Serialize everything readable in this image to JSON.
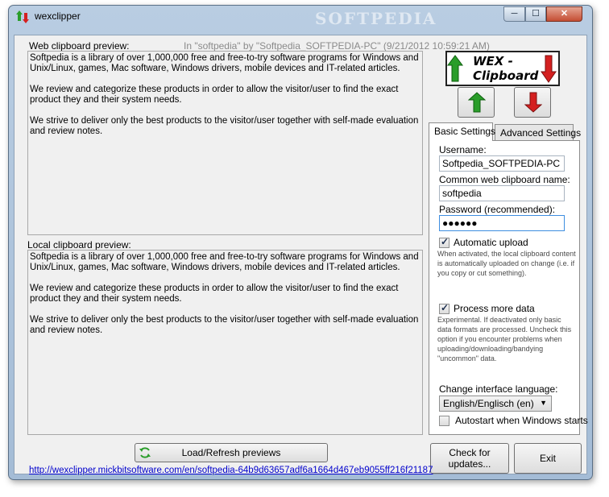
{
  "window": {
    "title": "wexclipper",
    "watermark": "SOFTPEDIA",
    "controls": {
      "minimize": "─",
      "maximize": "☐",
      "close": "✕"
    }
  },
  "web_preview": {
    "label": "Web clipboard preview:",
    "meta": "In \"softpedia\" by \"Softpedia_SOFTPEDIA-PC\" (9/21/2012 10:59:21 AM)",
    "paragraphs": [
      "Softpedia is a library of over 1,000,000 free and free-to-try software programs for Windows and Unix/Linux, games, Mac software, Windows drivers, mobile devices and IT-related articles.",
      "We review and categorize these products in order to allow the visitor/user to find the exact product they and their system needs.",
      "We strive to deliver only the best products to the visitor/user together with self-made evaluation and review notes."
    ]
  },
  "local_preview": {
    "label": "Local clipboard preview:",
    "paragraphs": [
      "Softpedia is a library of over 1,000,000 free and free-to-try software programs for Windows and Unix/Linux, games, Mac software, Windows drivers, mobile devices and IT-related articles.",
      "We review and categorize these products in order to allow the visitor/user to find the exact product they and their system needs.",
      "We strive to deliver only the best products to the visitor/user together with self-made evaluation and review notes."
    ]
  },
  "logo": {
    "line1": "WEX -",
    "line2": "Clipboard"
  },
  "tabs": [
    {
      "label": "Basic Settings",
      "active": true
    },
    {
      "label": "Advanced Settings",
      "active": false
    }
  ],
  "settings": {
    "username_label": "Username:",
    "username_value": "Softpedia_SOFTPEDIA-PC",
    "clipboard_name_label": "Common web clipboard name:",
    "clipboard_name_value": "softpedia",
    "password_label": "Password (recommended):",
    "password_value": "●●●●●●",
    "auto_upload_label": "Automatic upload",
    "auto_upload_checked": true,
    "auto_upload_hint": "When activated, the local clipboard content is automatically uploaded on change (i.e. if you copy or cut something).",
    "process_more_label": "Process more data",
    "process_more_checked": true,
    "process_more_hint": "Experimental. If deactivated only basic data formats are processed. Uncheck this option if you encounter problems when uploading/downloading/bandying \"uncommon\" data.",
    "language_label": "Change interface language:",
    "language_value": "English/Englisch (en)",
    "autostart_label": "Autostart when Windows starts",
    "autostart_checked": false
  },
  "buttons": {
    "load_refresh": "Load/Refresh previews",
    "check_updates_line1": "Check for",
    "check_updates_line2": "updates...",
    "exit": "Exit"
  },
  "link": "http://wexclipper.mickbitsoftware.com/en/softpedia-64b9d63657adf6a1664d467eb9055ff216f21187",
  "colors": {
    "accent_green": "#2a9d2a",
    "accent_red": "#d42020",
    "link": "#0000cc"
  }
}
